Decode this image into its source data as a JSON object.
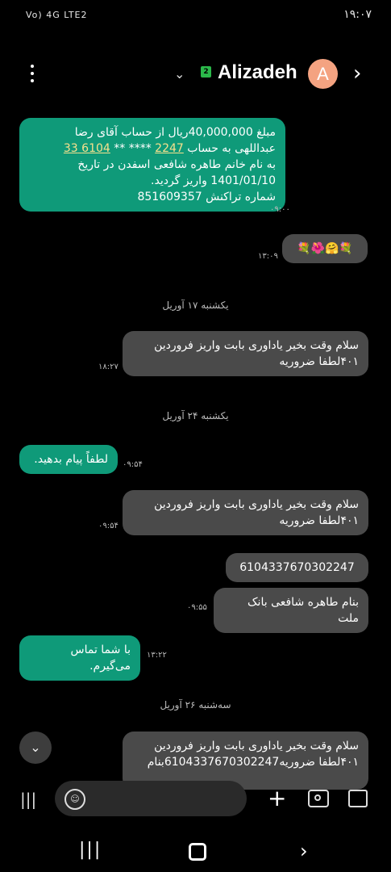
{
  "status_bar": {
    "left": "Vo) 4G LTE2",
    "time": "۱۹:۰۷"
  },
  "header": {
    "contact_name": "Alizadeh",
    "avatar_letter": "A",
    "sim": "2"
  },
  "messages": [
    {
      "type": "received",
      "lines": [
        "مبلغ 40,000,000ریال  از حساب آقای رضا",
        "عبداللهی به حساب",
        "به نام خانم طاهره   شافعی اسفدن در تاریخ",
        "1401/01/10 واریز گردید.",
        "شماره تراکنش 851609357"
      ],
      "link_a": "2247",
      "link_b": "6104 33",
      "masked": " **** ** ",
      "time": "۰۹:۰۰"
    },
    {
      "type": "sent",
      "text": "💐🤗🌺💐",
      "time": "۱۳:۰۹"
    },
    {
      "type": "date",
      "text": "یکشنبه ۱۷ آوریل"
    },
    {
      "type": "sent",
      "lines": [
        "سلام وقت بخیر یاداوری بابت واریز فروردین",
        "۴۰۱لطفا ضروریه"
      ],
      "time": "۱۸:۲۷"
    },
    {
      "type": "date",
      "text": "یکشنبه ۲۴ آوریل"
    },
    {
      "type": "received",
      "text": "لطفاً پیام بدهید.",
      "time": "۰۹:۵۴"
    },
    {
      "type": "sent",
      "lines": [
        "سلام وقت بخیر یاداوری بابت واریز فروردین",
        "۴۰۱لطفا ضروریه"
      ],
      "time": "۰۹:۵۴"
    },
    {
      "type": "sent",
      "text": "6104337670302247"
    },
    {
      "type": "sent",
      "text": "بنام طاهره شافعی بانک ملت",
      "time": "۰۹:۵۵"
    },
    {
      "type": "received",
      "text": "با شما تماس می‌گیرم.",
      "time": "۱۳:۲۲"
    },
    {
      "type": "date",
      "text": "سه‌شنبه ۲۶ آوریل"
    },
    {
      "type": "sent",
      "lines": [
        "سلام وقت بخیر یاداوری بابت واریز فروردین",
        "۴۰۱لطفا ضروریه6104337670302247بنام"
      ]
    }
  ]
}
